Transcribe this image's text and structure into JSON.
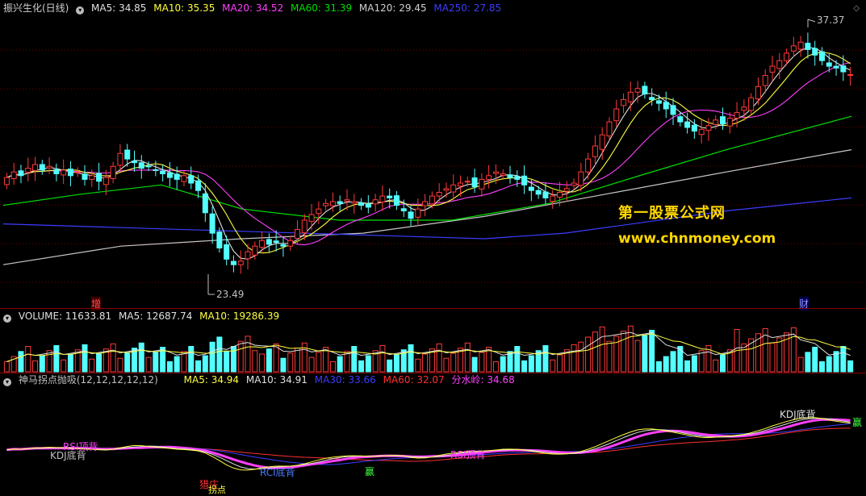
{
  "price_panel": {
    "title": "振兴生化(日线)",
    "ma5": "MA5: 34.85",
    "ma10": "MA10: 35.35",
    "ma20": "MA20: 34.52",
    "ma60": "MA60: 31.39",
    "ma120": "MA120: 29.45",
    "ma250": "MA250: 27.85",
    "high_label": "37.37",
    "low_label": "23.49",
    "marker_left": "增",
    "marker_right": "财"
  },
  "volume_panel": {
    "vol": "VOLUME: 11633.81",
    "ma5": "MA5: 12687.74",
    "ma10": "MA10: 19286.39"
  },
  "indicator_panel": {
    "name": "神马拐点抛吸(12,12,12,12,12)",
    "ma5": "MA5: 34.94",
    "ma10": "MA10: 34.91",
    "ma30": "MA30: 33.66",
    "ma60": "MA60: 32.07",
    "watershed": "分水岭: 34.68",
    "labels": {
      "rsi_top1": "RSI顶背",
      "kdj_bottom": "KDJ底背",
      "rci_bottom": "RCI底背",
      "win1": "赢",
      "rsi_top2": "RSI顶背",
      "kdj_bottom2": "KDJ底背",
      "win2": "赢",
      "zhuang": "猎庄",
      "guaidian": "拐点"
    }
  },
  "watermark": {
    "line1": "第一股票公式网",
    "line2": "www.chnmoney.com"
  },
  "colors": {
    "up": "#ff3a3a",
    "down": "#54ffff",
    "ma5": "#e0e0e0",
    "ma10": "#ffff40",
    "ma20": "#ff40ff",
    "ma60": "#00e000",
    "ma120": "#c8c8c8",
    "ma250": "#3c3cff",
    "grid": "#8b0000"
  },
  "chart_data": {
    "type": "candlestick",
    "ylim": [
      23.49,
      37.37
    ],
    "closes": [
      29.3,
      29.6,
      29.4,
      29.8,
      30.0,
      29.7,
      29.9,
      29.5,
      29.7,
      29.4,
      29.6,
      29.2,
      29.4,
      29.1,
      29.3,
      29.9,
      30.6,
      30.3,
      30.1,
      29.8,
      29.9,
      29.7,
      29.5,
      29.3,
      29.2,
      29.4,
      29.0,
      28.6,
      27.4,
      26.3,
      25.5,
      24.9,
      24.6,
      24.8,
      25.3,
      25.6,
      25.9,
      25.7,
      25.8,
      25.6,
      25.9,
      26.5,
      27.0,
      27.3,
      27.6,
      27.9,
      28.0,
      27.9,
      28.1,
      28.0,
      27.8,
      27.7,
      28.1,
      28.3,
      28.2,
      27.8,
      27.5,
      27.1,
      27.6,
      28.0,
      28.3,
      28.5,
      28.7,
      28.9,
      29.0,
      29.1,
      28.8,
      29.2,
      29.4,
      29.6,
      29.5,
      29.3,
      29.2,
      28.9,
      28.6,
      28.4,
      28.2,
      28.3,
      28.5,
      28.7,
      29.0,
      29.6,
      30.3,
      31.0,
      31.6,
      32.3,
      33.0,
      33.5,
      33.9,
      34.1,
      33.8,
      33.5,
      33.3,
      33.0,
      32.7,
      32.3,
      32.0,
      31.8,
      31.9,
      32.1,
      32.4,
      32.2,
      32.5,
      32.8,
      33.1,
      33.6,
      34.2,
      34.8,
      35.3,
      35.6,
      36.0,
      36.4,
      36.6,
      36.2,
      35.9,
      35.6,
      35.3,
      35.2,
      35.0,
      34.85
    ]
  }
}
